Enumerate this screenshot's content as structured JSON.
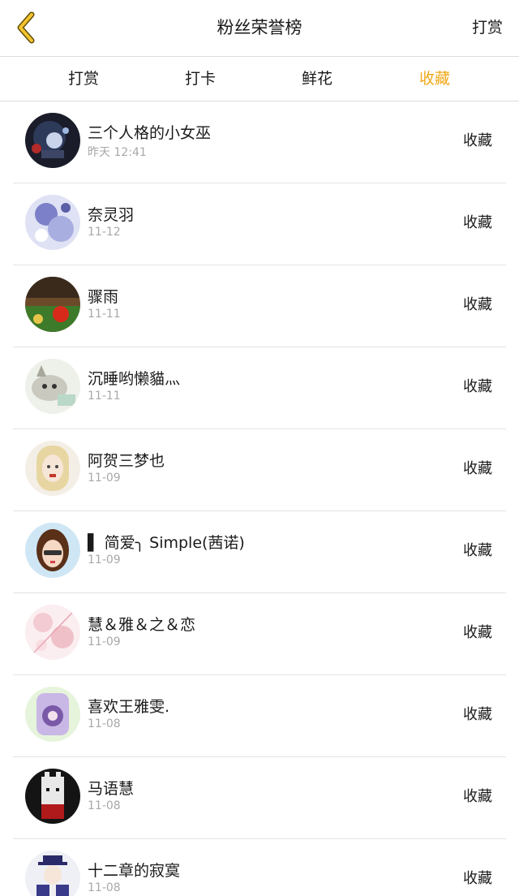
{
  "header": {
    "title": "粉丝荣誉榜",
    "right_action": "打赏",
    "back_icon": "chevron-left-icon",
    "accent_color": "#f0a818"
  },
  "tabs": [
    {
      "label": "打赏",
      "active": false
    },
    {
      "label": "打卡",
      "active": false
    },
    {
      "label": "鲜花",
      "active": false
    },
    {
      "label": "收藏",
      "active": true
    }
  ],
  "list": [
    {
      "name": "三个人格的小女巫",
      "date": "昨天 12:41",
      "action": "收藏"
    },
    {
      "name": "奈灵羽",
      "date": "11-12",
      "action": "收藏"
    },
    {
      "name": "骤雨",
      "date": "11-11",
      "action": "收藏"
    },
    {
      "name": "沉睡哟懒貓灬",
      "date": "11-11",
      "action": "收藏"
    },
    {
      "name": "阿贺三梦也",
      "date": "11-09",
      "action": "收藏"
    },
    {
      "name": "▌ 简爱╮ Simple(茜诺)",
      "date": "11-09",
      "action": "收藏"
    },
    {
      "name": "慧＆雅＆之＆恋",
      "date": "11-09",
      "action": "收藏"
    },
    {
      "name": "喜欢王雅雯.",
      "date": "11-08",
      "action": "收藏"
    },
    {
      "name": "马语慧",
      "date": "11-08",
      "action": "收藏"
    },
    {
      "name": "十二章的寂寞",
      "date": "11-08",
      "action": "收藏"
    }
  ]
}
